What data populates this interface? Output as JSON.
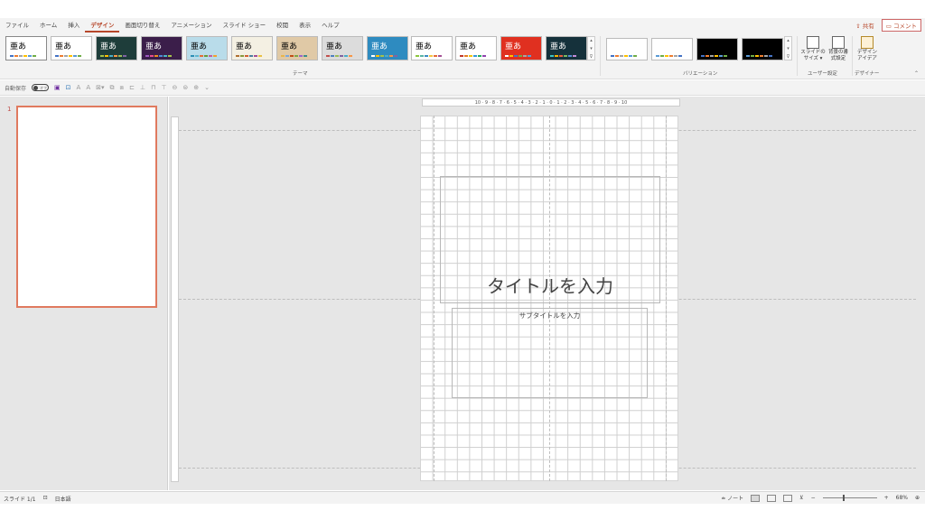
{
  "menu": {
    "tabs": [
      "ファイル",
      "ホーム",
      "挿入",
      "デザイン",
      "画面切り替え",
      "アニメーション",
      "スライド ショー",
      "校閲",
      "表示",
      "ヘルプ"
    ],
    "active_tab": "デザイン",
    "share_label": "共有",
    "comment_label": "コメント"
  },
  "ribbon": {
    "themes_group_label": "テーマ",
    "variations_group_label": "バリエーション",
    "user_settings_group_label": "ユーザー設定",
    "designer_group_label": "デザイナー",
    "theme_glyph": "亜あ",
    "slide_size_label": "スライドの\nサイズ ▾",
    "bg_format_label": "背景の書\n式設定",
    "design_ideas_label": "デザイン\nアイデア",
    "themes": [
      {
        "bg": "#ffffff",
        "fg": "#000000",
        "bars": [
          "#4472c4",
          "#ed7d31",
          "#a5a5a5",
          "#ffc000",
          "#5b9bd5",
          "#70ad47"
        ]
      },
      {
        "bg": "#ffffff",
        "fg": "#000000",
        "bars": [
          "#4472c4",
          "#ed7d31",
          "#a5a5a5",
          "#ffc000",
          "#5b9bd5",
          "#70ad47"
        ]
      },
      {
        "bg": "#1e3d3a",
        "fg": "#ffffff",
        "bars": [
          "#a5c249",
          "#ffc000",
          "#4bacc6",
          "#f79646",
          "#9bbb59",
          "#8064a2"
        ]
      },
      {
        "bg": "#3b1e4a",
        "fg": "#ffffff",
        "bars": [
          "#9d56c0",
          "#e84c8a",
          "#ef8d22",
          "#4d8ad6",
          "#4ab5c4",
          "#a5c249"
        ]
      },
      {
        "bg": "#b9dcea",
        "fg": "#000000",
        "bars": [
          "#2c8fb5",
          "#60b5cc",
          "#e66c37",
          "#6b9b3a",
          "#c75d9b",
          "#f0a030"
        ]
      },
      {
        "bg": "#f4f0e3",
        "fg": "#000000",
        "bars": [
          "#b07030",
          "#8a9a3b",
          "#d06030",
          "#4d7fa0",
          "#a55095",
          "#eac143"
        ]
      },
      {
        "bg": "#e0c9a6",
        "fg": "#000000",
        "bars": [
          "#e8b54d",
          "#7da7d9",
          "#c04f15",
          "#7ea646",
          "#9966cc",
          "#3c8d8d"
        ]
      },
      {
        "bg": "#dcdcdc",
        "fg": "#000000",
        "bars": [
          "#c0504d",
          "#4f81bd",
          "#9bbb59",
          "#8064a2",
          "#4bacc6",
          "#f79646"
        ]
      },
      {
        "bg": "#2e8bc0",
        "fg": "#ffffff",
        "bars": [
          "#ffffff",
          "#ffc000",
          "#a5c249",
          "#4bacc6",
          "#f79646",
          "#8064a2"
        ]
      },
      {
        "bg": "#ffffff",
        "fg": "#000000",
        "bars": [
          "#8dc63f",
          "#5bb5a5",
          "#3b8bc1",
          "#f6c342",
          "#e66c37",
          "#a55095"
        ]
      },
      {
        "bg": "#ffffff",
        "fg": "#000000",
        "bars": [
          "#c0392b",
          "#e67e22",
          "#f1c40f",
          "#3498db",
          "#27ae60",
          "#8e44ad"
        ]
      },
      {
        "bg": "#e03020",
        "fg": "#ffffff",
        "bars": [
          "#ffffff",
          "#ffc000",
          "#4472c4",
          "#70ad47",
          "#a5a5a5",
          "#5b9bd5"
        ]
      },
      {
        "bg": "#15313b",
        "fg": "#ffffff",
        "bars": [
          "#3dc4c4",
          "#f4b400",
          "#e85c41",
          "#7bb661",
          "#5a8dd6",
          "#c28ad6"
        ]
      }
    ],
    "variations": [
      {
        "bg": "#ffffff",
        "bars": [
          "#4472c4",
          "#ed7d31",
          "#a5a5a5",
          "#ffc000",
          "#5b9bd5",
          "#70ad47"
        ]
      },
      {
        "bg": "#ffffff",
        "bars": [
          "#5b9bd5",
          "#70ad47",
          "#ffc000",
          "#ed7d31",
          "#a5a5a5",
          "#4472c4"
        ]
      },
      {
        "bg": "#000000",
        "bars": [
          "#4472c4",
          "#ed7d31",
          "#a5a5a5",
          "#ffc000",
          "#5b9bd5",
          "#70ad47"
        ]
      },
      {
        "bg": "#000000",
        "bars": [
          "#5b9bd5",
          "#70ad47",
          "#ffc000",
          "#ed7d31",
          "#a5a5a5",
          "#4472c4"
        ]
      }
    ]
  },
  "qat": {
    "autosave_label": "自動保存",
    "autosave_state": "オフ"
  },
  "slides_pane": {
    "slide_number": "1"
  },
  "ruler": {
    "horizontal_text": "10 · 9 · 8 · 7 · 6 · 5 · 4 · 3 · 2 · 1 · 0 · 1 · 2 · 3 · 4 · 5 · 6 · 7 · 8 · 9 · 10"
  },
  "slide": {
    "title_placeholder": "タイトルを入力",
    "subtitle_placeholder": "サブタイトルを入力"
  },
  "status": {
    "slide_indicator": "スライド 1/1",
    "language": "日本語",
    "notes_label": "ノート",
    "zoom": "68%"
  }
}
